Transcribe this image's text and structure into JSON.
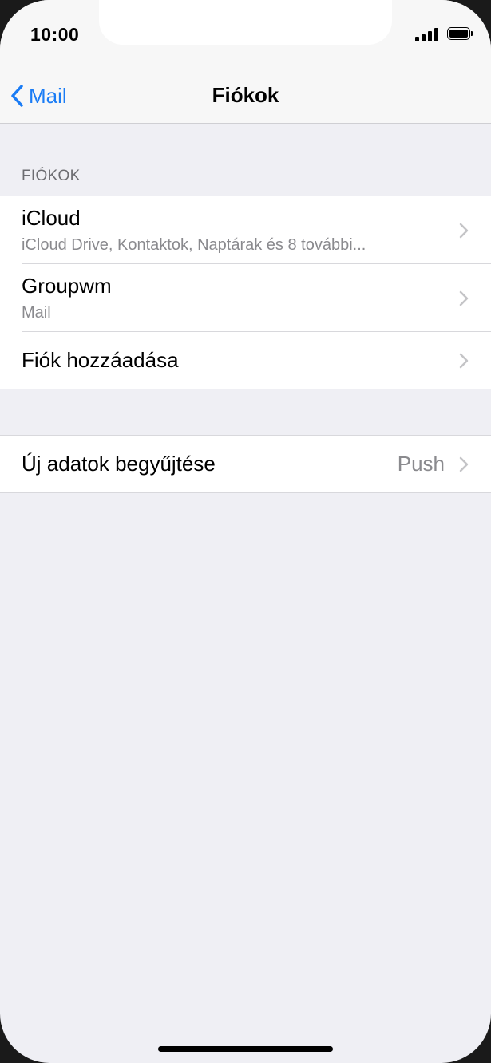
{
  "status_bar": {
    "time": "10:00",
    "signal_icon": "cellular-signal-icon",
    "battery_icon": "battery-full-icon"
  },
  "nav": {
    "back_label": "Mail",
    "back_icon": "chevron-left-icon",
    "title": "Fiókok",
    "accent_color": "#1a7cf5"
  },
  "accounts_section": {
    "header": "FIÓKOK",
    "rows": [
      {
        "title": "iCloud",
        "subtitle": "iCloud Drive, Kontaktok, Naptárak és 8 további..."
      },
      {
        "title": "Groupwm",
        "subtitle": "Mail"
      },
      {
        "title": "Fiók hozzáadása"
      }
    ]
  },
  "fetch_section": {
    "title": "Új adatok begyűjtése",
    "value": "Push"
  }
}
